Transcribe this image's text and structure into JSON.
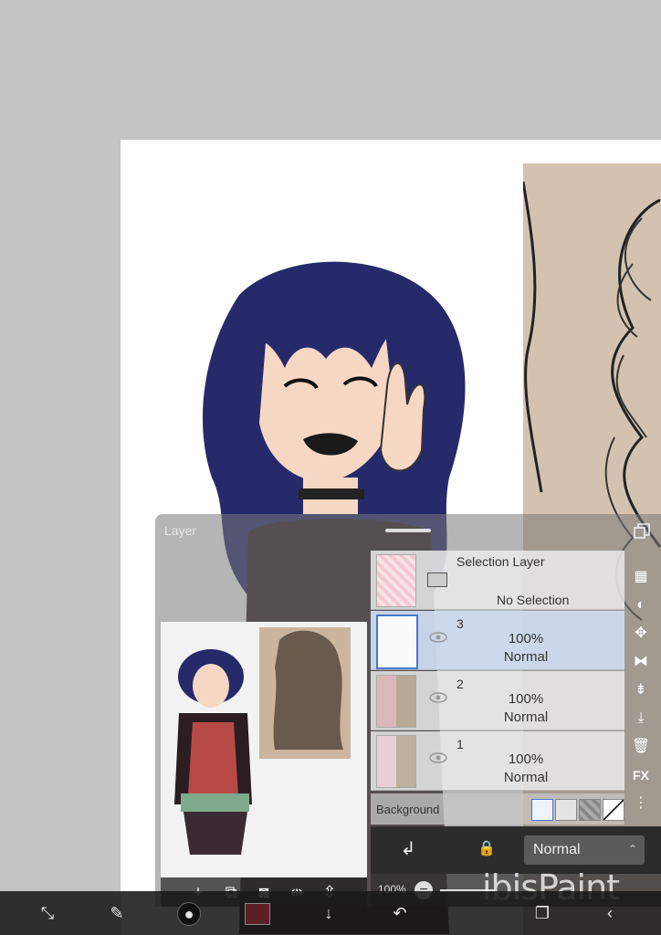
{
  "app": {
    "watermark": "ibisPaint"
  },
  "layer_panel": {
    "title": "Layer",
    "selection_layer": {
      "name": "Selection Layer",
      "status": "No Selection"
    },
    "layers": [
      {
        "number": "3",
        "opacity": "100%",
        "blend": "Normal",
        "selected": true
      },
      {
        "number": "2",
        "opacity": "100%",
        "blend": "Normal",
        "selected": false
      },
      {
        "number": "1",
        "opacity": "100%",
        "blend": "Normal",
        "selected": false
      }
    ],
    "background_label": "Background",
    "blend_mode_value": "Normal",
    "opacity_value": "100%"
  },
  "colors": {
    "canvas_bg": "#c4c4c4",
    "hair": "#262a6b",
    "skin": "#f6d7c3",
    "current_color": "#5c1f25",
    "selected_layer": "#cddaee"
  },
  "icons": {
    "layer_side_tools": [
      "transparency-icon",
      "invert-icon",
      "move-icon",
      "flip-icon",
      "merge-down-icon",
      "import-icon",
      "trash-icon",
      "fx-icon",
      "more-icon"
    ],
    "preview_toolbar": [
      "add-layer-icon",
      "duplicate-layer-icon",
      "camera-icon",
      "flip-horizontal-icon",
      "flip-vertical-icon"
    ],
    "bottom_toolbar": [
      "transform-icon",
      "brush-icon",
      "brush-size-icon",
      "color-swatch",
      "down-arrow-icon",
      "undo-icon",
      "layers-icon",
      "back-icon"
    ]
  }
}
